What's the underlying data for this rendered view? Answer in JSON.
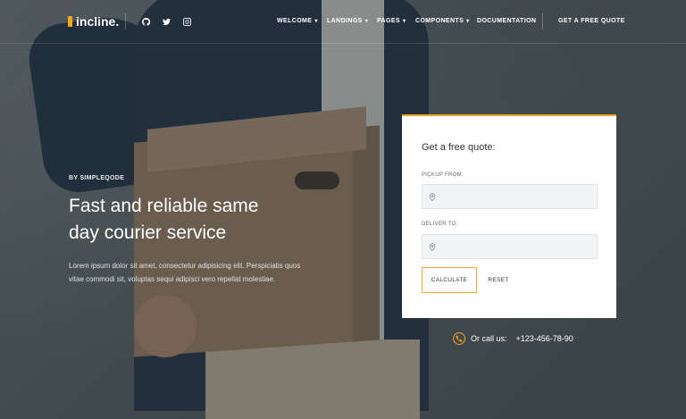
{
  "brand": {
    "name": "incline.",
    "accent": "#f5a623"
  },
  "social": [
    "github-icon",
    "twitter-icon",
    "instagram-icon"
  ],
  "nav": {
    "items": [
      {
        "label": "WELCOME",
        "dropdown": true
      },
      {
        "label": "LANDINGS",
        "dropdown": true
      },
      {
        "label": "PAGES",
        "dropdown": true
      },
      {
        "label": "COMPONENTS",
        "dropdown": true
      },
      {
        "label": "DOCUMENTATION",
        "dropdown": false
      }
    ],
    "cta": "GET A FREE QUOTE"
  },
  "hero": {
    "byline": "BY SIMPLEQODE",
    "headline_line1": "Fast and reliable same",
    "headline_line2": "day courier service",
    "lead": "Lorem ipsum dolor sit amet, consectetur adipisicing elit. Perspiciatis quos vitae commodi sit, voluptas sequi adipisci vero repellat molestiae."
  },
  "quote_form": {
    "title": "Get a free quote:",
    "pickup_label": "PICKUP FROM:",
    "pickup_value": "",
    "deliver_label": "DELIVER TO:",
    "deliver_value": "",
    "calculate_label": "CALCULATE",
    "reset_label": "RESET"
  },
  "contact": {
    "prompt": "Or call us:",
    "phone": "+123-456-78-90"
  }
}
